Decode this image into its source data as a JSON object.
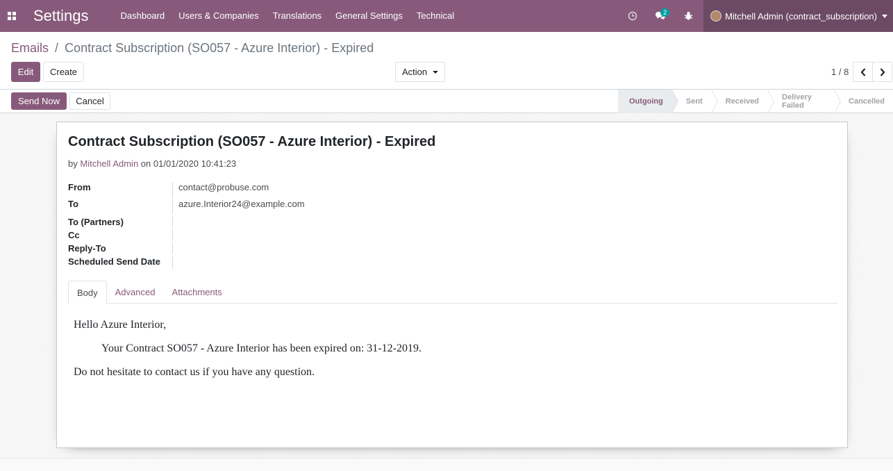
{
  "navbar": {
    "brand": "Settings",
    "menu": [
      "Dashboard",
      "Users & Companies",
      "Translations",
      "General Settings",
      "Technical"
    ],
    "messages_count": "2",
    "user_name": "Mitchell Admin (contract_subscription)"
  },
  "breadcrumb": {
    "parent": "Emails",
    "separator": "/",
    "current": "Contract Subscription (SO057 - Azure Interior) - Expired"
  },
  "buttons": {
    "edit": "Edit",
    "create": "Create",
    "action": "Action",
    "send_now": "Send Now",
    "cancel": "Cancel"
  },
  "pager": {
    "value": "1 / 8"
  },
  "stages": [
    "Outgoing",
    "Sent",
    "Received",
    "Delivery Failed",
    "Cancelled"
  ],
  "active_stage": "Outgoing",
  "record": {
    "title": "Contract Subscription (SO057 - Azure Interior) - Expired",
    "by_prefix": "by",
    "author": "Mitchell Admin",
    "on_prefix": "on",
    "date": "01/01/2020 10:41:23",
    "fields": [
      {
        "label": "From",
        "value": "contact@probuse.com"
      },
      {
        "label": "To",
        "value": "azure.Interior24@example.com"
      },
      {
        "label": "To (Partners)",
        "value": ""
      },
      {
        "label": "Cc",
        "value": ""
      },
      {
        "label": "Reply-To",
        "value": ""
      },
      {
        "label": "Scheduled Send Date",
        "value": ""
      }
    ]
  },
  "tabs": [
    "Body",
    "Advanced",
    "Attachments"
  ],
  "body": {
    "greeting": "Hello Azure Interior,",
    "line": "Your Contract SO057 - Azure Interior has been expired on: 31-12-2019.",
    "closing": "Do not hesitate to contact us if you have any question."
  },
  "colors": {
    "brand": "#875a7b",
    "user_menu": "#6c4a64",
    "badge": "#00a09d"
  }
}
